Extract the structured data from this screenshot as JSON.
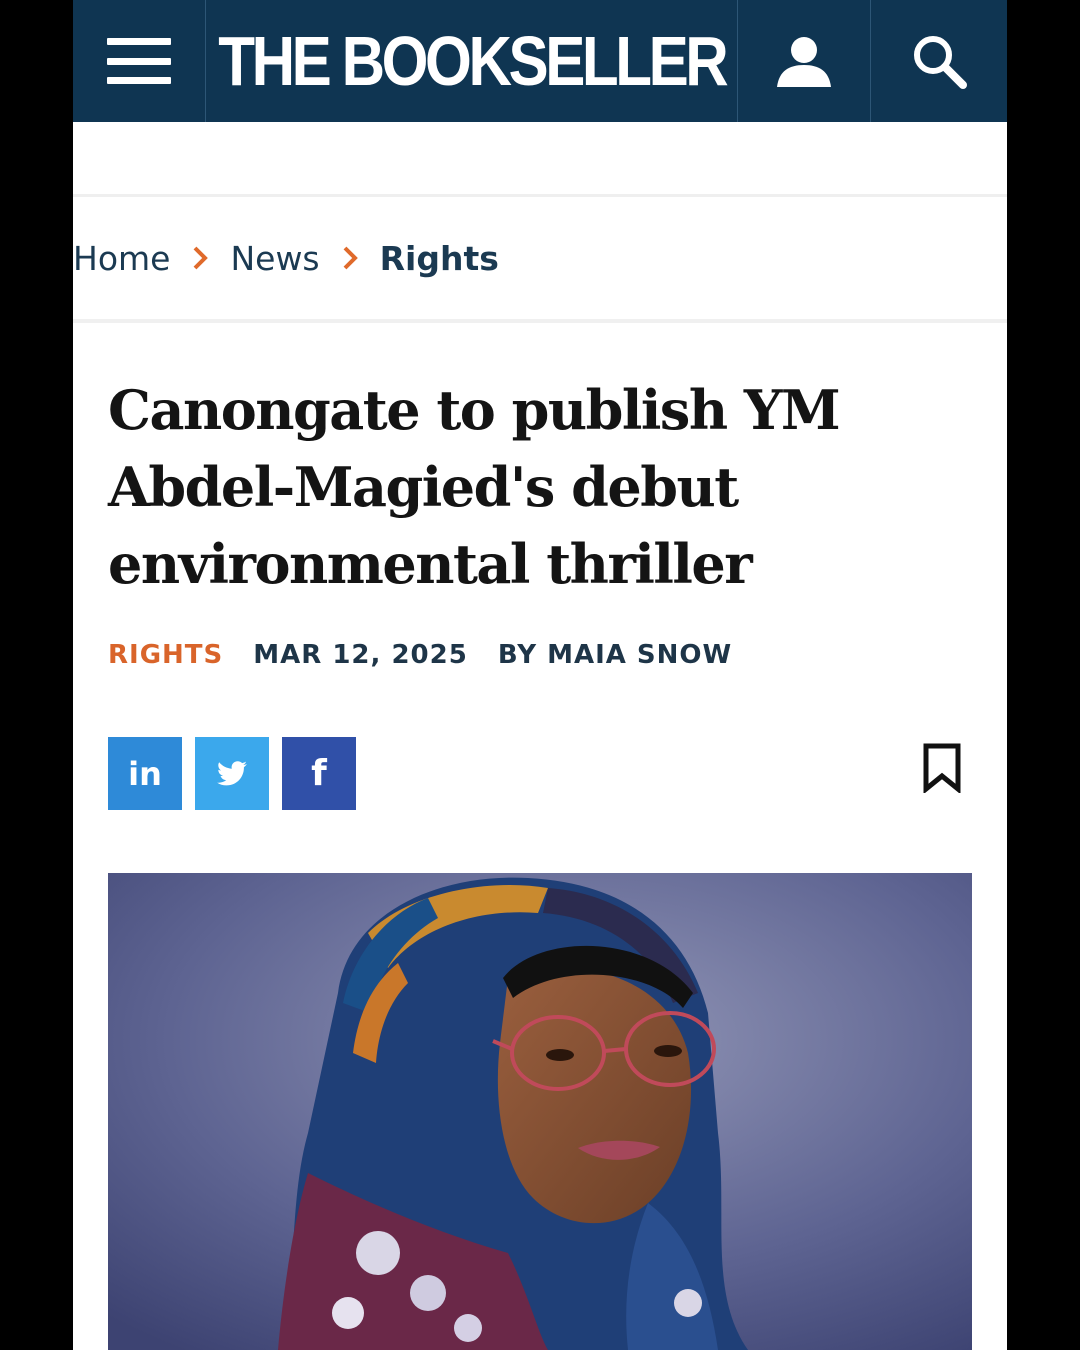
{
  "header": {
    "logo": "THE BOOKSELLER",
    "icons": {
      "menu": "hamburger-menu-icon",
      "account": "user-icon",
      "search": "search-icon"
    }
  },
  "breadcrumb": [
    {
      "label": "Home"
    },
    {
      "label": "News"
    },
    {
      "label": "Rights"
    }
  ],
  "article": {
    "headline": "Canongate to publish YM Abdel-Magied's debut environmental thriller",
    "category": "RIGHTS",
    "date": "MAR 12, 2025",
    "byline": "BY MAIA SNOW"
  },
  "share": {
    "linkedin": "in",
    "twitter": "twitter-bird-icon",
    "facebook": "f"
  },
  "colors": {
    "header_bg": "#0f3552",
    "accent_orange": "#d9642a",
    "linkedin": "#2e8ad8",
    "twitter": "#3ba8ec",
    "facebook": "#3050a8"
  }
}
